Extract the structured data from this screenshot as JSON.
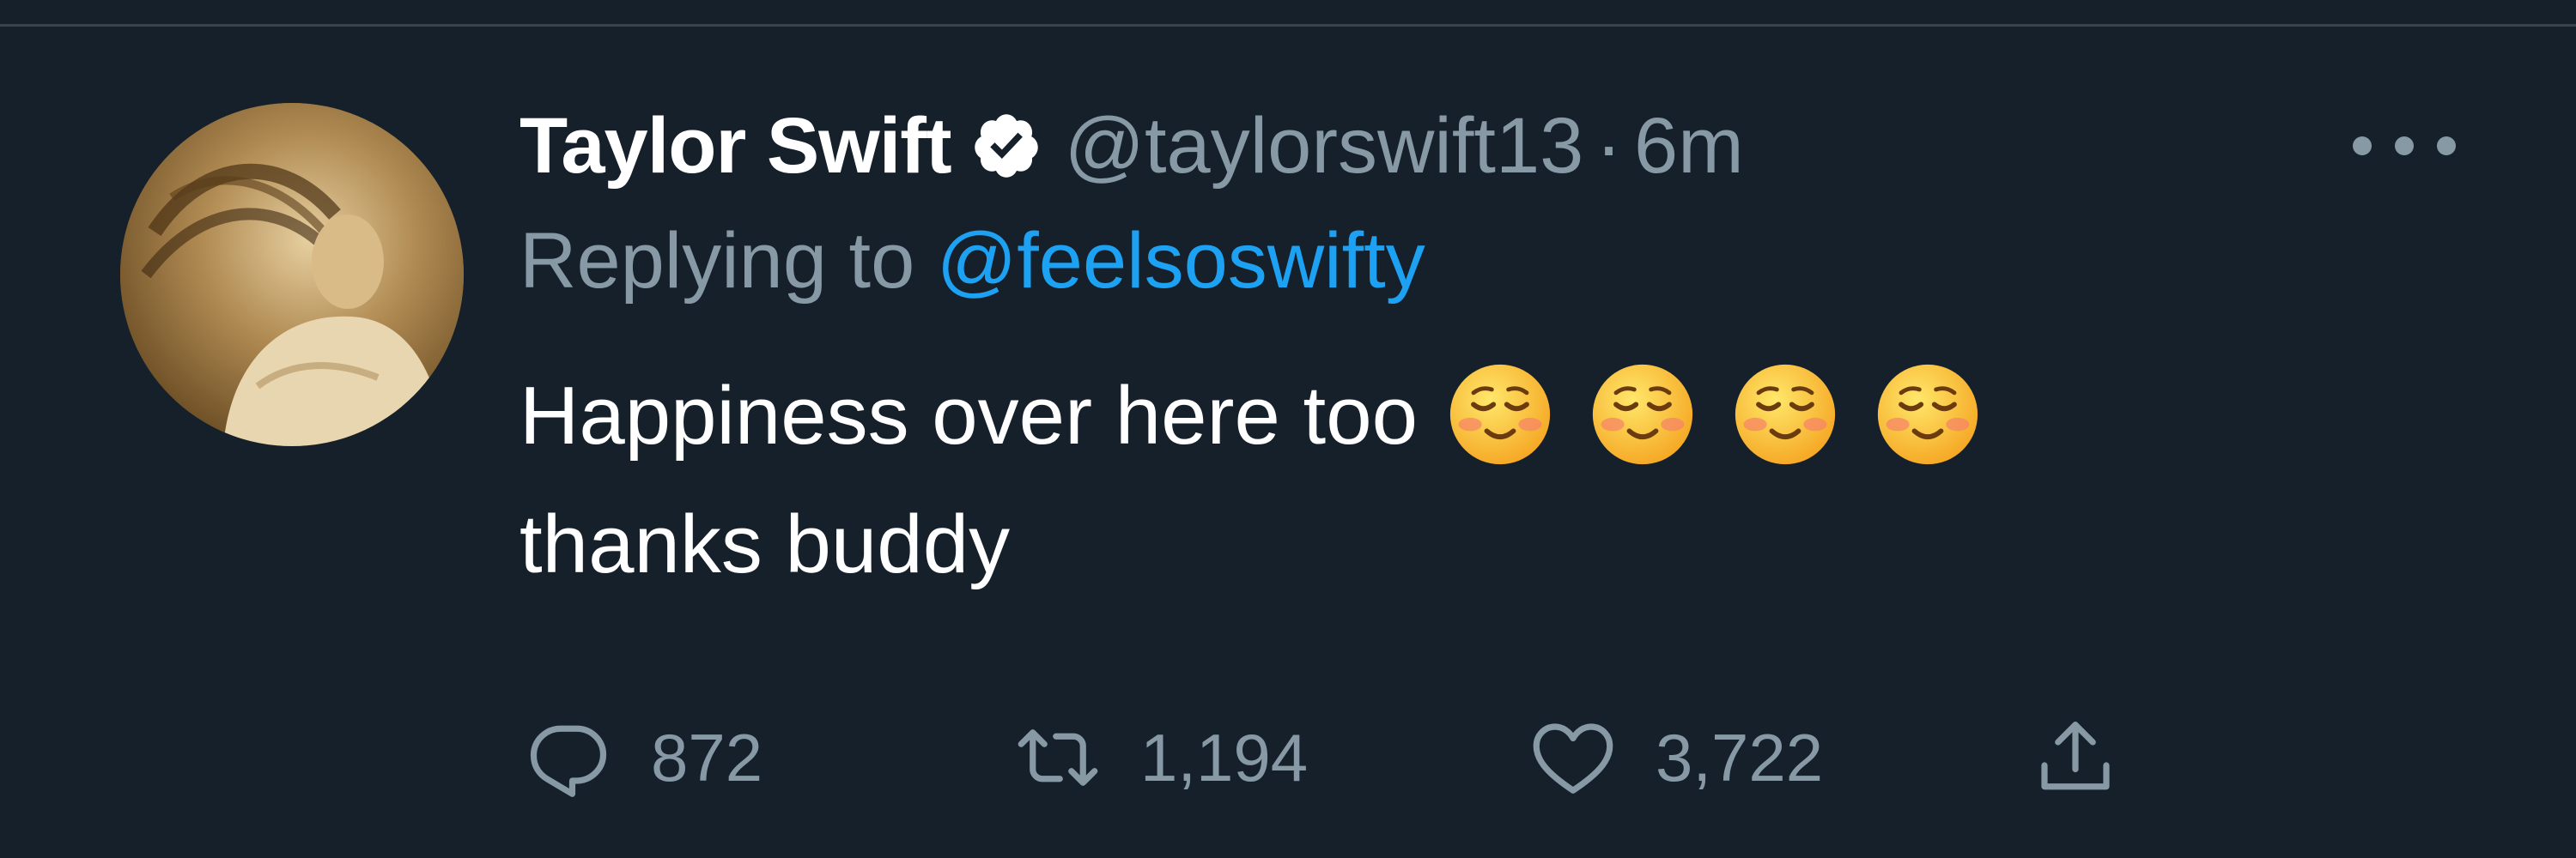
{
  "tweet": {
    "display_name": "Taylor Swift",
    "handle": "@taylorswift13",
    "separator": "·",
    "time": "6m",
    "reply_prefix": "Replying to",
    "reply_to": "@feelsoswifty",
    "text_line1": "Happiness over here too",
    "text_line2": "thanks buddy",
    "emojis": [
      "smiling-face-emoji",
      "smiling-face-emoji",
      "smiling-face-emoji",
      "smiling-face-emoji"
    ]
  },
  "actions": {
    "reply_count": "872",
    "retweet_count": "1,194",
    "like_count": "3,722"
  },
  "icons": {
    "verified": "verified-badge-icon",
    "more": "more-options-icon",
    "reply": "reply-icon",
    "retweet": "retweet-icon",
    "like": "heart-icon",
    "share": "share-icon"
  },
  "colors": {
    "background": "#15202b",
    "primary_text": "#ffffff",
    "secondary_text": "#8899a6",
    "link": "#1da1f2"
  }
}
